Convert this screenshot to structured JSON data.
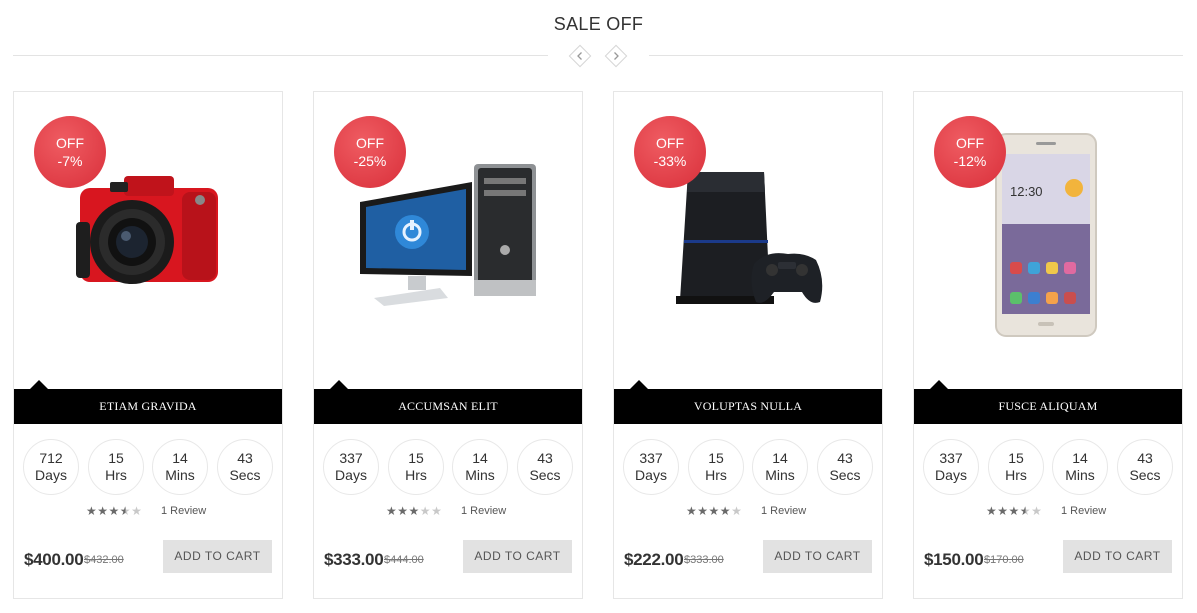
{
  "section": {
    "title": "SALE OFF",
    "prev_icon": "chevron-left-icon",
    "next_icon": "chevron-right-icon"
  },
  "colors": {
    "badge": "#e0414a",
    "name_bar": "#000000",
    "cart_button": "#e2e2e2",
    "star_on": "#6a6a6a",
    "star_off": "#c9c9c9"
  },
  "products": [
    {
      "image": "camera-image",
      "badge": {
        "label": "OFF",
        "value": "-7%"
      },
      "name": "ETIAM GRAVIDA",
      "countdown": {
        "days": "712",
        "days_label": "Days",
        "hrs": "15",
        "hrs_label": "Hrs",
        "mins": "14",
        "mins_label": "Mins",
        "secs": "43",
        "secs_label": "Secs"
      },
      "rating": 3.5,
      "review": "1 Review",
      "price": "$400.00",
      "old_price": "$432.00",
      "cart_label": "ADD TO CART"
    },
    {
      "image": "desktop-computer-image",
      "badge": {
        "label": "OFF",
        "value": "-25%"
      },
      "name": "ACCUMSAN ELIT",
      "countdown": {
        "days": "337",
        "days_label": "Days",
        "hrs": "15",
        "hrs_label": "Hrs",
        "mins": "14",
        "mins_label": "Mins",
        "secs": "43",
        "secs_label": "Secs"
      },
      "rating": 3,
      "review": "1 Review",
      "price": "$333.00",
      "old_price": "$444.00",
      "cart_label": "ADD TO CART"
    },
    {
      "image": "game-console-image",
      "badge": {
        "label": "OFF",
        "value": "-33%"
      },
      "name": "VOLUPTAS NULLA",
      "countdown": {
        "days": "337",
        "days_label": "Days",
        "hrs": "15",
        "hrs_label": "Hrs",
        "mins": "14",
        "mins_label": "Mins",
        "secs": "43",
        "secs_label": "Secs"
      },
      "rating": 4,
      "review": "1 Review",
      "price": "$222.00",
      "old_price": "$333.00",
      "cart_label": "ADD TO CART"
    },
    {
      "image": "smartphone-image",
      "badge": {
        "label": "OFF",
        "value": "-12%"
      },
      "name": "FUSCE ALIQUAM",
      "countdown": {
        "days": "337",
        "days_label": "Days",
        "hrs": "15",
        "hrs_label": "Hrs",
        "mins": "14",
        "mins_label": "Mins",
        "secs": "43",
        "secs_label": "Secs"
      },
      "rating": 3.5,
      "review": "1 Review",
      "price": "$150.00",
      "old_price": "$170.00",
      "cart_label": "ADD TO CART"
    }
  ]
}
